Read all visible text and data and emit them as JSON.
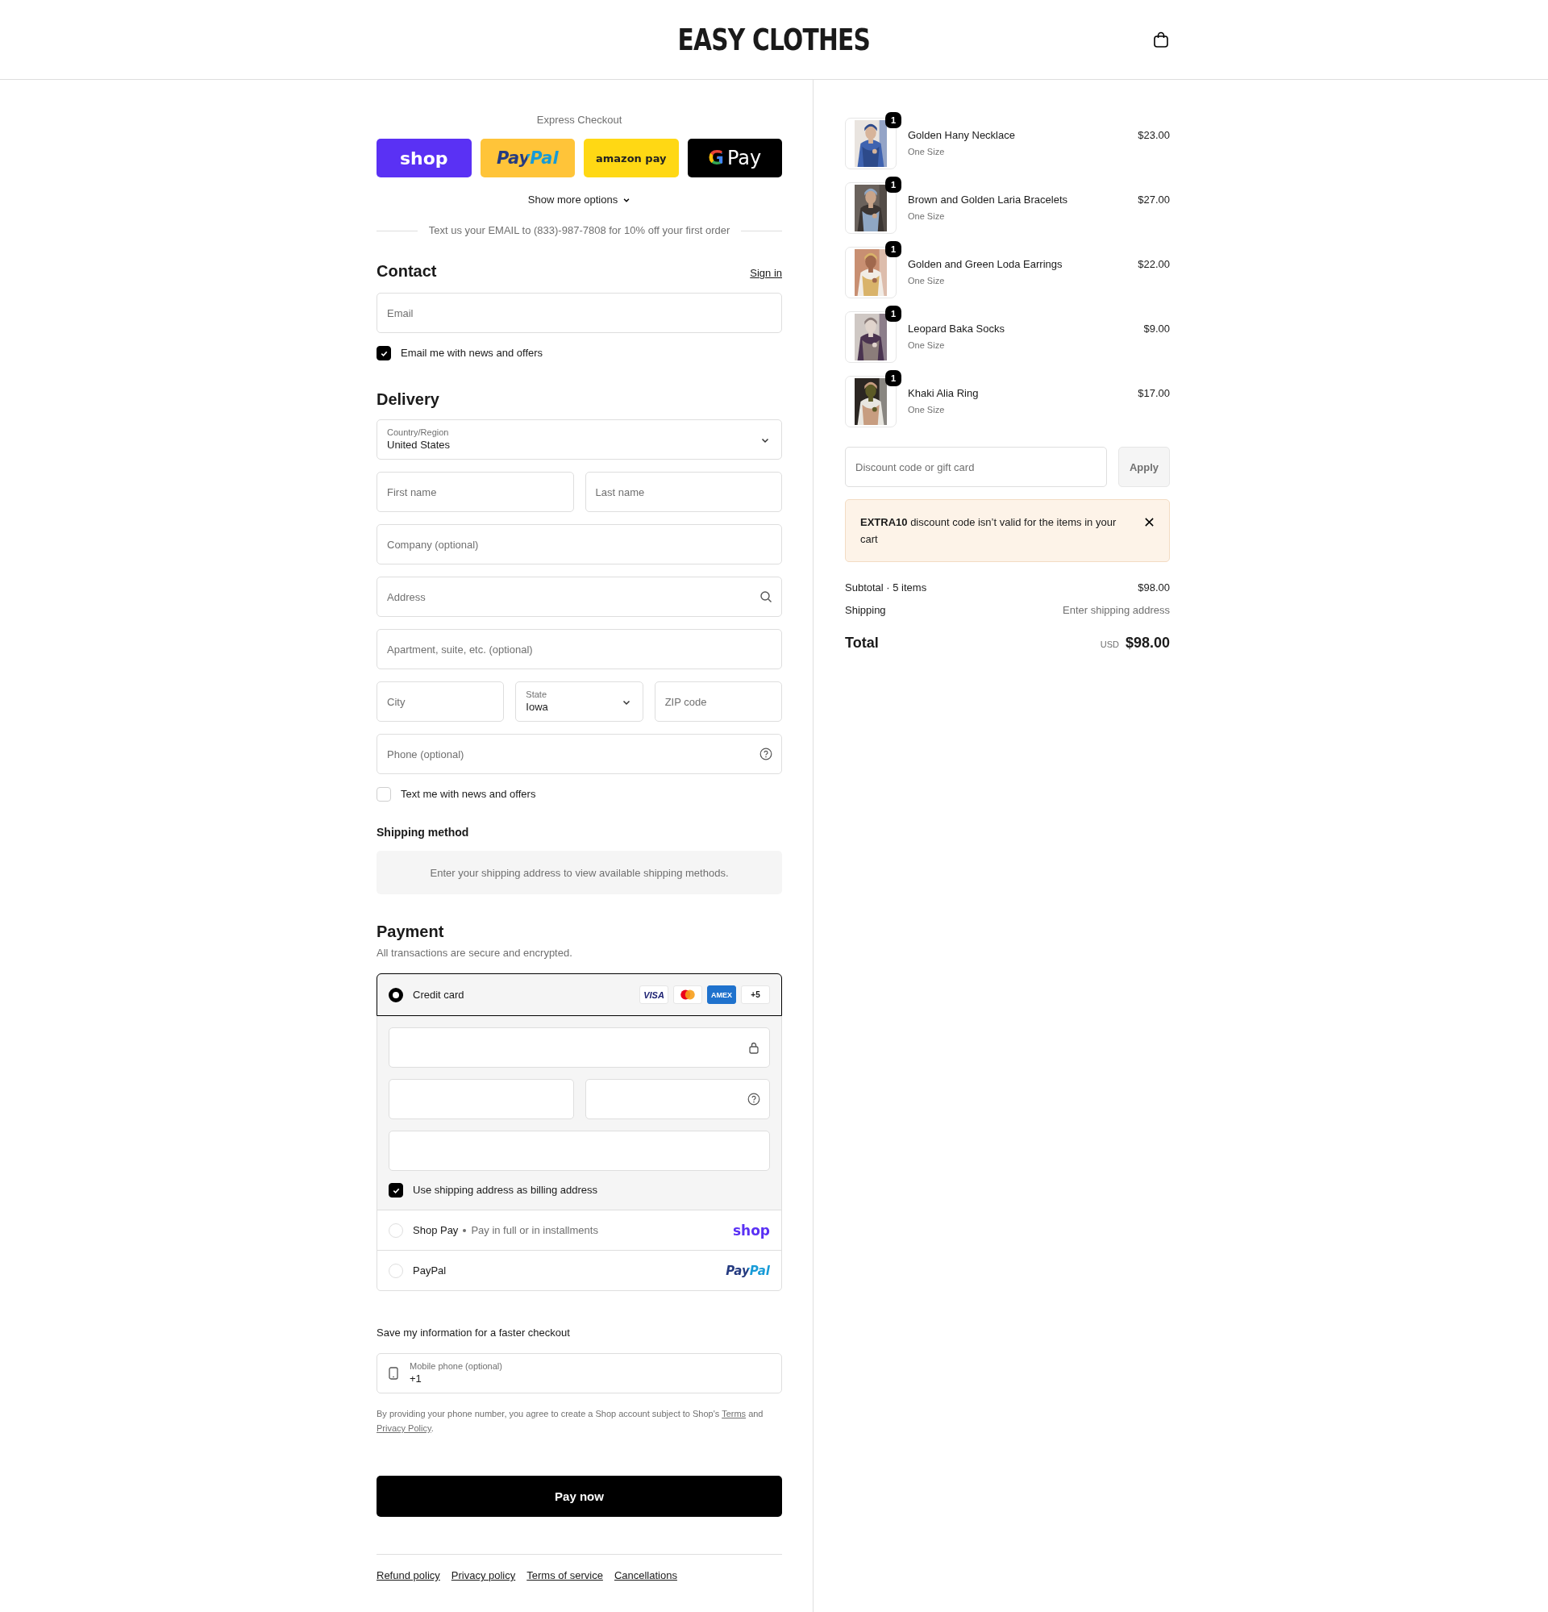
{
  "header": {
    "logo": "EASY CLOTHES"
  },
  "express_checkout": {
    "title": "Express Checkout",
    "buttons": [
      {
        "kind": "shop",
        "label": "shop"
      },
      {
        "kind": "paypal",
        "label": "PayPal"
      },
      {
        "kind": "amazon",
        "label": "amazon pay"
      },
      {
        "kind": "gpay",
        "mark": "G",
        "label": "Pay"
      }
    ],
    "show_more": "Show more options",
    "promo": "Text us your EMAIL to (833)-987-7808 for 10% off your first order"
  },
  "contact": {
    "title": "Contact",
    "sign_in": "Sign in",
    "email": {
      "placeholder": "Email"
    },
    "news": {
      "label": "Email me with news and offers",
      "checked": true
    }
  },
  "delivery": {
    "title": "Delivery",
    "rows": [
      [
        {
          "kind": "select",
          "label": "Country/Region",
          "value": "United States"
        }
      ],
      [
        {
          "kind": "input",
          "placeholder": "First name"
        },
        {
          "kind": "input",
          "placeholder": "Last name"
        }
      ],
      [
        {
          "kind": "input",
          "placeholder": "Company (optional)"
        }
      ],
      [
        {
          "kind": "search",
          "placeholder": "Address"
        }
      ],
      [
        {
          "kind": "input",
          "placeholder": "Apartment, suite, etc. (optional)"
        }
      ],
      [
        {
          "kind": "input",
          "placeholder": "City"
        },
        {
          "kind": "select",
          "label": "State",
          "value": "Iowa"
        },
        {
          "kind": "input",
          "placeholder": "ZIP code"
        }
      ],
      [
        {
          "kind": "help",
          "placeholder": "Phone (optional)"
        }
      ]
    ],
    "text_news": {
      "label": "Text me with news and offers",
      "checked": false
    }
  },
  "shipping_method": {
    "title": "Shipping method",
    "message": "Enter your shipping address to view available shipping methods."
  },
  "payment": {
    "title": "Payment",
    "subtitle": "All transactions are secure and encrypted.",
    "methods": [
      {
        "kind": "card",
        "label": "Credit card",
        "selected": true,
        "brands": [
          {
            "kind": "visa",
            "label": "VISA"
          },
          {
            "kind": "mastercard"
          },
          {
            "kind": "amex",
            "label": "AMEX"
          },
          {
            "kind": "more",
            "label": "+5"
          }
        ],
        "billing": {
          "label": "Use shipping address as billing address",
          "checked": true
        }
      },
      {
        "kind": "shop_pay",
        "label": "Shop Pay",
        "note": "Pay in full or in installments",
        "logo": "shop",
        "selected": false
      },
      {
        "kind": "paypal",
        "label": "PayPal",
        "logo": "PayPal",
        "selected": false
      }
    ]
  },
  "save_info": {
    "title": "Save my information for a faster checkout",
    "phone": {
      "label": "Mobile phone (optional)",
      "value": "+1"
    },
    "legal": [
      {
        "kind": "text",
        "text": "By providing your phone number, you agree to create a Shop account subject to Shop's "
      },
      {
        "kind": "link",
        "text": "Terms"
      },
      {
        "kind": "text",
        "text": " and "
      },
      {
        "kind": "link",
        "text": "Privacy Policy"
      },
      {
        "kind": "text",
        "text": "."
      }
    ]
  },
  "pay_button": "Pay now",
  "footer_links": [
    "Refund policy",
    "Privacy policy",
    "Terms of service",
    "Cancellations"
  ],
  "summary": {
    "items": [
      {
        "name": "Golden Hany Necklace",
        "variant": "One Size",
        "price": "$23.00",
        "quantity": "1"
      },
      {
        "name": "Brown and Golden Laria Bracelets",
        "variant": "One Size",
        "price": "$27.00",
        "quantity": "1"
      },
      {
        "name": "Golden and Green Loda Earrings",
        "variant": "One Size",
        "price": "$22.00",
        "quantity": "1"
      },
      {
        "name": "Leopard Baka Socks",
        "variant": "One Size",
        "price": "$9.00",
        "quantity": "1"
      },
      {
        "name": "Khaki Alia Ring",
        "variant": "One Size",
        "price": "$17.00",
        "quantity": "1"
      }
    ],
    "discount": {
      "placeholder": "Discount code or gift card",
      "button": "Apply",
      "disabled": true
    },
    "error": "**EXTRA10** discount code isn’t valid for the items in your cart",
    "subtotal_label": "Subtotal · 5 items",
    "subtotal": "$98.00",
    "shipping_label": "Shipping",
    "shipping": "Enter shipping address",
    "total_label": "Total",
    "currency": "USD",
    "total": "$98.00"
  }
}
